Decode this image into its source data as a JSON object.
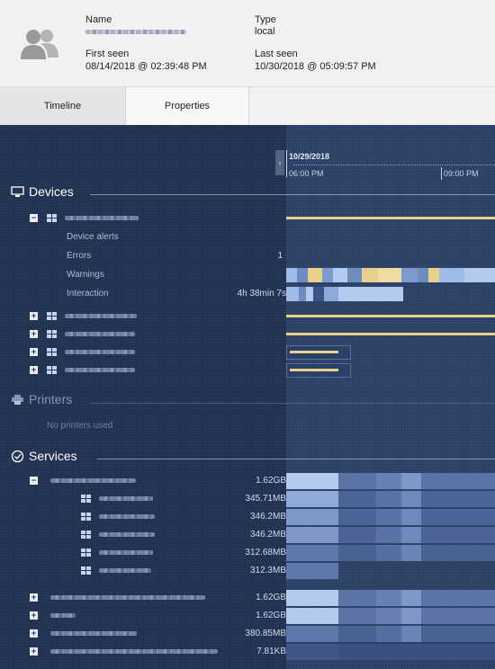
{
  "header": {
    "name_label": "Name",
    "type_label": "Type",
    "type_value": "local",
    "first_seen_label": "First seen",
    "first_seen_value": "08/14/2018 @ 02:39:48 PM",
    "last_seen_label": "Last seen",
    "last_seen_value": "10/30/2018 @ 05:09:57 PM"
  },
  "tabs": [
    {
      "label": "Timeline",
      "active": false
    },
    {
      "label": "Properties",
      "active": true
    }
  ],
  "timeline": {
    "date": "10/29/2018",
    "ticks": [
      "06:00 PM",
      "09:00 PM"
    ]
  },
  "devices": {
    "title": "Devices",
    "detail_labels": [
      "Device alerts",
      "Errors",
      "Warnings",
      "Interaction"
    ],
    "errors_count": "1",
    "interaction_value": "4h 38min 7s"
  },
  "printers": {
    "title": "Printers",
    "empty_text": "No printers used"
  },
  "services": {
    "title": "Services",
    "rows": [
      {
        "value": "1.62GB"
      },
      {
        "value": "345.71MB"
      },
      {
        "value": "346.2MB"
      },
      {
        "value": "346.2MB"
      },
      {
        "value": "312.68MB"
      },
      {
        "value": "312.3MB"
      },
      {
        "value": "1.62GB"
      },
      {
        "value": "1.62GB"
      },
      {
        "value": "380.85MB"
      },
      {
        "value": "7.81KB"
      }
    ]
  },
  "colors": {
    "pane_bg": "#2a3e60",
    "yellow_bar": "#e8d08a",
    "blue_bar": "#9fbbe8"
  },
  "icons": {
    "user": "user-group-icon",
    "device": "monitor-icon",
    "printer": "printer-icon",
    "service": "gauge-icon",
    "os": "windows-icon"
  }
}
